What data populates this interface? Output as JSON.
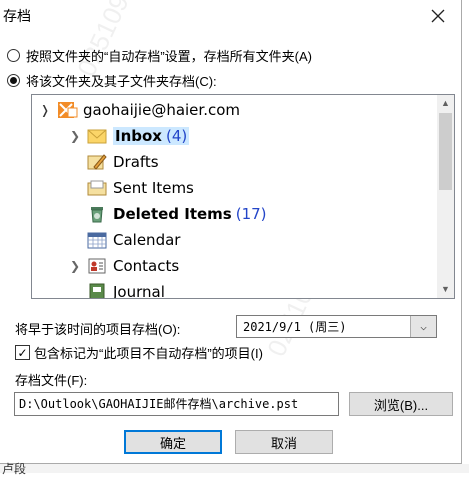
{
  "title": "存档",
  "option_auto": "按照文件夹的“自动存档”设置，存档所有文件夹(A)",
  "option_this": "将该文件夹及其子文件夹存档(C):",
  "tree": {
    "account": "gaohaijie@haier.com",
    "inbox": {
      "label": "Inbox",
      "count": "(4)"
    },
    "drafts": "Drafts",
    "sent": "Sent Items",
    "deleted": {
      "label": "Deleted Items",
      "count": "(17)"
    },
    "calendar": "Calendar",
    "contacts": "Contacts",
    "journal": "Journal"
  },
  "archive_before_label": "将早于该时间的项目存档(O):",
  "archive_before_value": "2021/9/1 (周三)",
  "include_label": "包含标记为“此项目不自动存档”的项目(I)",
  "file_label": "存档文件(F):",
  "file_path": "D:\\Outlook\\GAOHAIJIE邮件存档\\archive.pst",
  "browse_label": "浏览(B)...",
  "ok_label": "确定",
  "cancel_label": "取消",
  "watermark": "025109",
  "bottom_fragment": "卢段",
  "colors": {
    "accent": "#0078d7",
    "count": "#2345c8",
    "selected": "#cce8ff"
  }
}
